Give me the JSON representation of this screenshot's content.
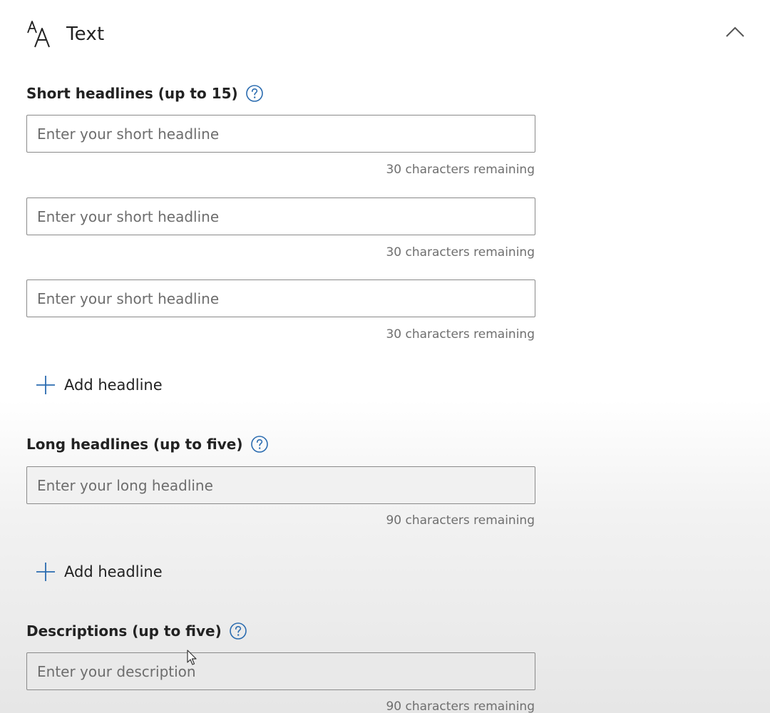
{
  "section": {
    "title": "Text",
    "icon": "text-format-icon",
    "collapse_icon": "chevron-up-icon"
  },
  "short_headlines": {
    "label": "Short headlines (up to 15)",
    "fields": [
      {
        "placeholder": "Enter your short headline",
        "value": "",
        "counter": "30 characters remaining"
      },
      {
        "placeholder": "Enter your short headline",
        "value": "",
        "counter": "30 characters remaining"
      },
      {
        "placeholder": "Enter your short headline",
        "value": "",
        "counter": "30 characters remaining"
      }
    ],
    "add_label": "Add headline"
  },
  "long_headlines": {
    "label": "Long headlines (up to five)",
    "fields": [
      {
        "placeholder": "Enter your long headline",
        "value": "",
        "counter": "90 characters remaining"
      }
    ],
    "add_label": "Add headline"
  },
  "descriptions": {
    "label": "Descriptions (up to five)",
    "fields": [
      {
        "placeholder": "Enter your description",
        "value": "",
        "counter": "90 characters remaining"
      }
    ]
  },
  "colors": {
    "accent": "#2b6cb0",
    "text": "#222222",
    "muted": "#6f6f6f",
    "border": "#8a8a8a"
  }
}
